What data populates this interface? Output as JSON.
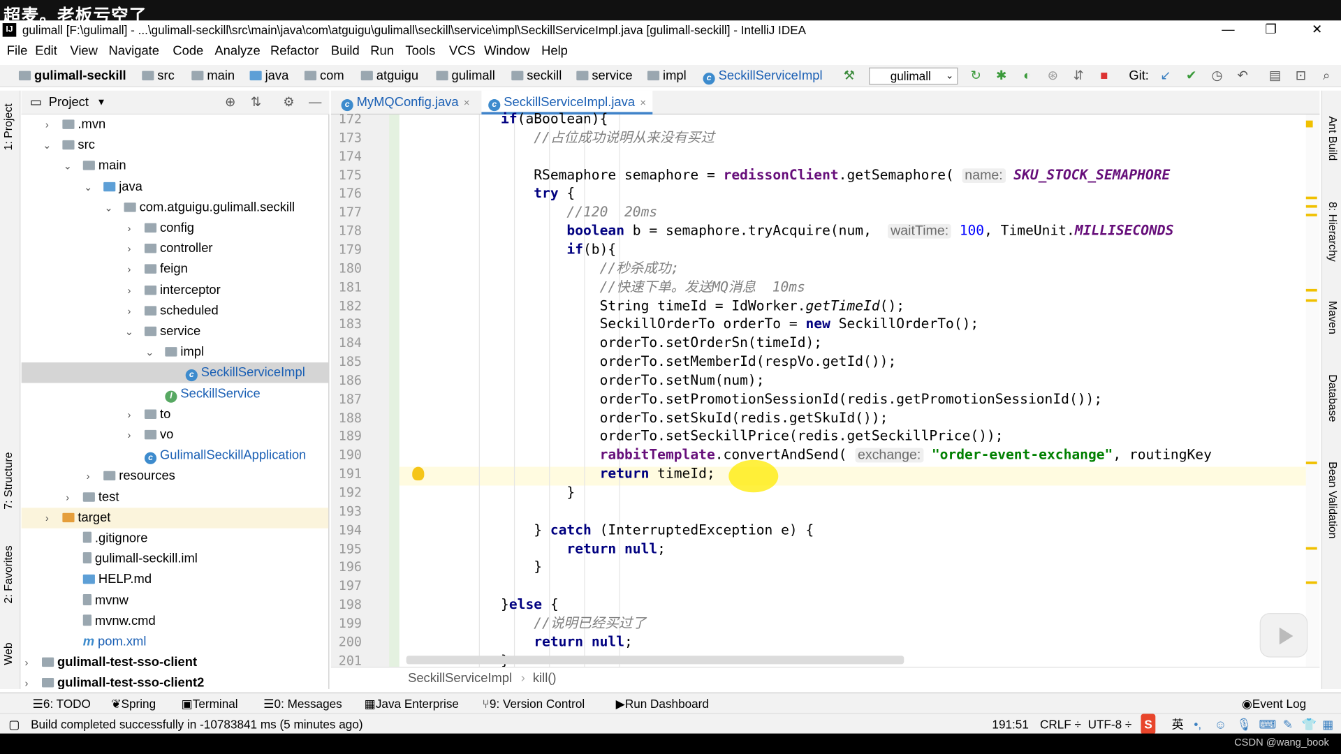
{
  "watermark": "超麦。老板亏空了",
  "window": {
    "title": "gulimall [F:\\gulimall] - ...\\gulimall-seckill\\src\\main\\java\\com\\atguigu\\gulimall\\seckill\\service\\impl\\SeckillServiceImpl.java [gulimall-seckill] - IntelliJ IDEA",
    "minimize": "—",
    "restore": "❐",
    "close": "✕"
  },
  "menu": [
    "File",
    "Edit",
    "View",
    "Navigate",
    "Code",
    "Analyze",
    "Refactor",
    "Build",
    "Run",
    "Tools",
    "VCS",
    "Window",
    "Help"
  ],
  "nav": {
    "crumbs": [
      "gulimall-seckill",
      "src",
      "main",
      "java",
      "com",
      "atguigu",
      "gulimall",
      "seckill",
      "service",
      "impl",
      "SeckillServiceImpl"
    ],
    "run_config": "gulimall",
    "git_label": "Git:"
  },
  "project_panel": {
    "title": "Project",
    "tree": [
      {
        "label": ".mvn",
        "arrow": "›",
        "icon": "folder"
      },
      {
        "label": "src",
        "arrow": "⌄",
        "icon": "folder"
      },
      {
        "label": "main",
        "arrow": "⌄",
        "icon": "folder"
      },
      {
        "label": "java",
        "arrow": "⌄",
        "icon": "folder-blue"
      },
      {
        "label": "com.atguigu.gulimall.seckill",
        "arrow": "⌄",
        "icon": "folder"
      },
      {
        "label": "config",
        "arrow": "›",
        "icon": "folder"
      },
      {
        "label": "controller",
        "arrow": "›",
        "icon": "folder"
      },
      {
        "label": "feign",
        "arrow": "›",
        "icon": "folder"
      },
      {
        "label": "interceptor",
        "arrow": "›",
        "icon": "folder"
      },
      {
        "label": "scheduled",
        "arrow": "›",
        "icon": "folder"
      },
      {
        "label": "service",
        "arrow": "⌄",
        "icon": "folder"
      },
      {
        "label": "impl",
        "arrow": "⌄",
        "icon": "folder"
      },
      {
        "label": "SeckillServiceImpl",
        "arrow": "",
        "icon": "class",
        "selected": true
      },
      {
        "label": "SeckillService",
        "arrow": "",
        "icon": "interface"
      },
      {
        "label": "to",
        "arrow": "›",
        "icon": "folder"
      },
      {
        "label": "vo",
        "arrow": "›",
        "icon": "folder"
      },
      {
        "label": "GulimallSeckillApplication",
        "arrow": "",
        "icon": "class"
      },
      {
        "label": "resources",
        "arrow": "›",
        "icon": "folder"
      },
      {
        "label": "test",
        "arrow": "›",
        "icon": "folder"
      },
      {
        "label": "target",
        "arrow": "›",
        "icon": "folder-orange",
        "highlight": true
      },
      {
        "label": ".gitignore",
        "arrow": "",
        "icon": "file"
      },
      {
        "label": "gulimall-seckill.iml",
        "arrow": "",
        "icon": "file"
      },
      {
        "label": "HELP.md",
        "arrow": "",
        "icon": "md"
      },
      {
        "label": "mvnw",
        "arrow": "",
        "icon": "file"
      },
      {
        "label": "mvnw.cmd",
        "arrow": "",
        "icon": "file"
      },
      {
        "label": "pom.xml",
        "arrow": "",
        "icon": "maven"
      },
      {
        "label": "gulimall-test-sso-client",
        "arrow": "›",
        "icon": "folder",
        "bold": true
      },
      {
        "label": "gulimall-test-sso-client2",
        "arrow": "›",
        "icon": "folder",
        "bold": true
      }
    ]
  },
  "tabs": [
    {
      "label": "MyMQConfig.java",
      "close": "×"
    },
    {
      "label": "SeckillServiceImpl.java",
      "close": "×",
      "active": true
    }
  ],
  "code": {
    "line_numbers": [
      "172",
      "173",
      "174",
      "175",
      "176",
      "177",
      "178",
      "179",
      "180",
      "181",
      "182",
      "183",
      "184",
      "185",
      "186",
      "187",
      "188",
      "189",
      "190",
      "191",
      "192",
      "193",
      "194",
      "195",
      "196",
      "197",
      "198",
      "199",
      "200",
      "201"
    ],
    "lines": [
      "            if(aBoolean){",
      "                //占位成功说明从来没有买过",
      "",
      "                RSemaphore semaphore = redissonClient.getSemaphore( name: SKU_STOCK_SEMAPHORE",
      "                try {",
      "                    //120  20ms",
      "                    boolean b = semaphore.tryAcquire(num,  waitTime: 100, TimeUnit.MILLISECONDS",
      "                    if(b){",
      "                        //秒杀成功;",
      "                        //快速下单。发送MQ消息  10ms",
      "                        String timeId = IdWorker.getTimeId();",
      "                        SeckillOrderTo orderTo = new SeckillOrderTo();",
      "                        orderTo.setOrderSn(timeId);",
      "                        orderTo.setMemberId(respVo.getId());",
      "                        orderTo.setNum(num);",
      "                        orderTo.setPromotionSessionId(redis.getPromotionSessionId());",
      "                        orderTo.setSkuId(redis.getSkuId());",
      "                        orderTo.setSeckillPrice(redis.getSeckillPrice());",
      "                        rabbitTemplate.convertAndSend( exchange: \"order-event-exchange\", routingKey",
      "                        return timeId;",
      "                    }",
      "",
      "                } catch (InterruptedException e) {",
      "                    return null;",
      "                }",
      "",
      "            }else {",
      "                //说明已经买过了",
      "                return null;",
      "            }"
    ]
  },
  "editor_breadcrumb": [
    "SeckillServiceImpl",
    "kill()"
  ],
  "left_tool_tabs": [
    "1: Project",
    "7: Structure",
    "2: Favorites",
    "Web"
  ],
  "right_tool_tabs": [
    "Ant Build",
    "8: Hierarchy",
    "Maven",
    "Database",
    "Bean Validation"
  ],
  "bottom_tools": [
    "6: TODO",
    "Spring",
    "Terminal",
    "0: Messages",
    "Java Enterprise",
    "9: Version Control",
    "Run Dashboard",
    "Event Log"
  ],
  "status": {
    "message": "Build completed successfully in -10783841 ms (5 minutes ago)",
    "position": "191:51",
    "line_sep": "CRLF ÷",
    "encoding": "UTF-8 ÷",
    "ime": "英"
  },
  "credit": "CSDN @wang_book",
  "colors": {
    "keyword": "#000080",
    "comment": "#808080",
    "string": "#008000",
    "field": "#660e7a",
    "accent": "#4083c9"
  }
}
